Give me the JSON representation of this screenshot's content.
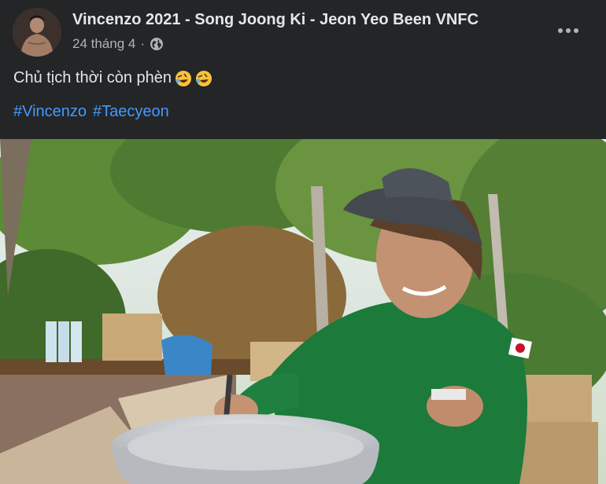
{
  "post": {
    "author": "Vincenzo 2021 - Song Joong Ki - Jeon Yeo Been VNFC",
    "date": "24 tháng 4",
    "separator": "·",
    "privacy_icon": "globe-icon",
    "caption": "Chủ tịch thời còn phèn",
    "caption_emojis": [
      "rolling-on-floor-laughing-emoji",
      "rolling-on-floor-laughing-emoji"
    ],
    "hashtags": [
      "#Vincenzo",
      "#Taecyeon"
    ],
    "more_icon": "more-options-icon"
  },
  "photo": {
    "subject": "man-in-hat-stirring-pot",
    "colors": {
      "shirt": "#1c7a3b",
      "hat": "#4a5058",
      "foliage": "#4f7a32",
      "sky": "#dfe9ef"
    }
  },
  "colors": {
    "background": "#242526",
    "text": "#e4e6eb",
    "muted": "#b0b3b8",
    "link": "#4599ff"
  }
}
